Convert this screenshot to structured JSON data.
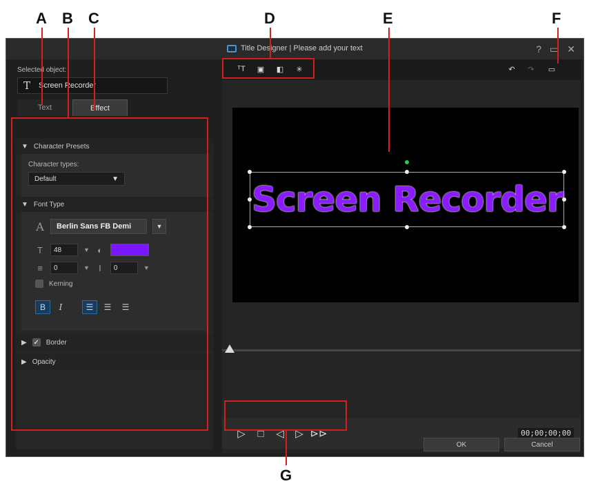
{
  "callouts": [
    "A",
    "B",
    "C",
    "D",
    "E",
    "F",
    "G"
  ],
  "window": {
    "title": "Title Designer | Please add your text",
    "controls": [
      "?",
      "▭",
      "✕"
    ]
  },
  "left": {
    "selected_label": "Selected object:",
    "selected_value": "Screen Recorder",
    "tabs": [
      "Text",
      "Effect"
    ],
    "sections": {
      "presets": "Character Presets",
      "character_types_label": "Character types:",
      "character_types_value": "Default",
      "font_type": "Font Type",
      "font_name": "Berlin Sans FB Demi",
      "font_size": "48",
      "font_color": "#7b16ff",
      "line_spacing": "0",
      "char_spacing": "0",
      "kerning": "Kerning",
      "border": "Border",
      "opacity": "Opacity"
    }
  },
  "preview": {
    "text": "Screen Recorder",
    "text_color": "#8a1cff",
    "timecode": "00;00;00;00"
  },
  "footer": {
    "ok": "OK",
    "cancel": "Cancel"
  }
}
